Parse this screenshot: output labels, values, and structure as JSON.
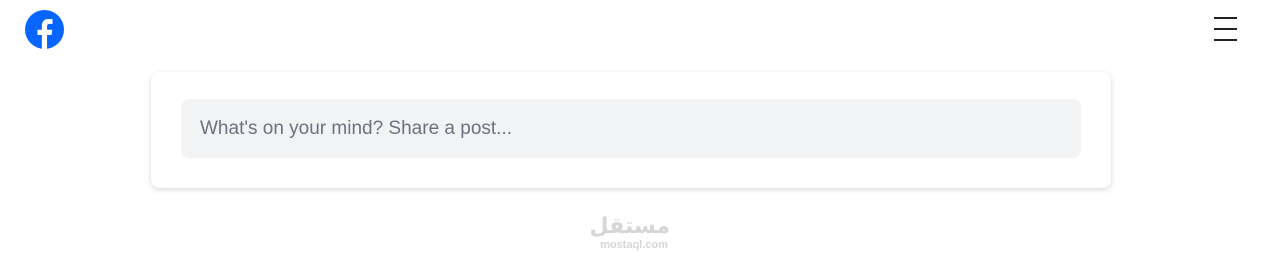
{
  "header": {
    "logo_icon": "facebook-logo-icon",
    "menu_icon": "hamburger-menu-icon",
    "brand_color": "#0866ff"
  },
  "composer": {
    "placeholder": "What's on your mind? Share a post..."
  },
  "watermark": {
    "logo_text": "مستقل",
    "domain": "mostaql.com"
  }
}
